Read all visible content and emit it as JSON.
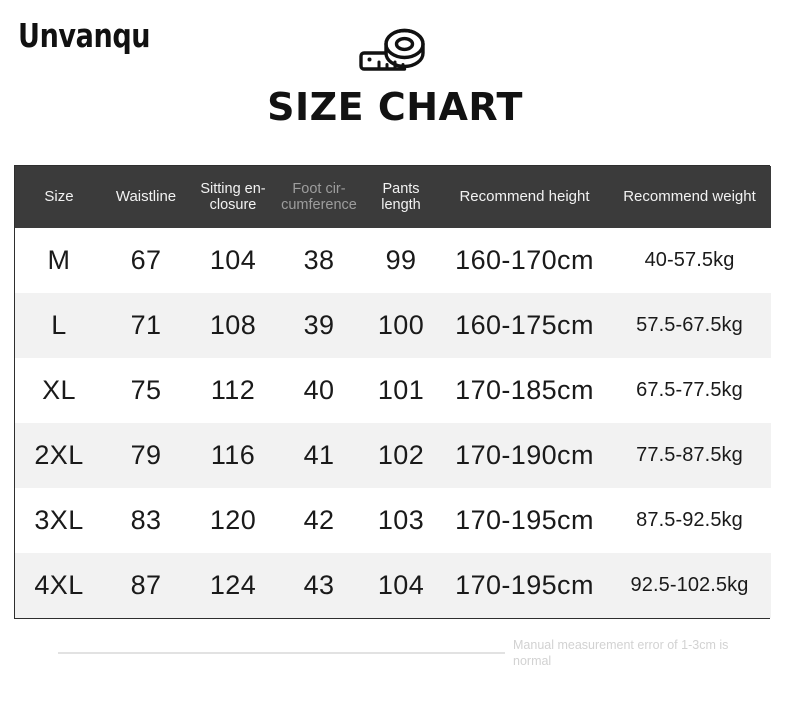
{
  "brand": {
    "name": "Unvanqu"
  },
  "title": {
    "text": "SIZE CHART",
    "icon": "tape-measure-icon"
  },
  "table": {
    "columns": [
      {
        "key": "size",
        "label": "Size"
      },
      {
        "key": "waist",
        "label": "Waistline"
      },
      {
        "key": "sit",
        "label": "Sitting en-closure"
      },
      {
        "key": "foot",
        "label": "Foot cir-cumference"
      },
      {
        "key": "pants",
        "label": "Pants length"
      },
      {
        "key": "height",
        "label": "Recommend height"
      },
      {
        "key": "weight",
        "label": "Recommend weight"
      }
    ],
    "header_labels": {
      "size": "Size",
      "waistline": "Waistline",
      "sitting_line1": "Sitting en-",
      "sitting_line2": "closure",
      "foot_line1": "Foot cir-",
      "foot_line2": "cumference",
      "pants_line1": "Pants",
      "pants_line2": "length",
      "recommend_height": "Recommend height",
      "recommend_weight": "Recommend weight"
    },
    "rows": [
      {
        "size": "M",
        "waist": "67",
        "sit": "104",
        "foot": "38",
        "pants": "99",
        "height": "160-170cm",
        "weight": "40-57.5kg"
      },
      {
        "size": "L",
        "waist": "71",
        "sit": "108",
        "foot": "39",
        "pants": "100",
        "height": "160-175cm",
        "weight": "57.5-67.5kg"
      },
      {
        "size": "XL",
        "waist": "75",
        "sit": "112",
        "foot": "40",
        "pants": "101",
        "height": "170-185cm",
        "weight": "67.5-77.5kg"
      },
      {
        "size": "2XL",
        "waist": "79",
        "sit": "116",
        "foot": "41",
        "pants": "102",
        "height": "170-190cm",
        "weight": "77.5-87.5kg"
      },
      {
        "size": "3XL",
        "waist": "83",
        "sit": "120",
        "foot": "42",
        "pants": "103",
        "height": "170-195cm",
        "weight": "87.5-92.5kg"
      },
      {
        "size": "4XL",
        "waist": "87",
        "sit": "124",
        "foot": "43",
        "pants": "104",
        "height": "170-195cm",
        "weight": "92.5-102.5kg"
      }
    ]
  },
  "footer": {
    "note": "Manual measurement error of 1-3cm is normal"
  },
  "colors": {
    "header_bg": "#3b3b3b",
    "header_text": "#f2f2f2",
    "header_text_dim": "#9d9d9d",
    "row_odd": "#ffffff",
    "row_even": "#f2f2f2",
    "border": "#2e2e2e",
    "body_text": "#1a1a1a",
    "footer_text": "#d2d2d2",
    "footer_rule": "#e2e2e2"
  }
}
